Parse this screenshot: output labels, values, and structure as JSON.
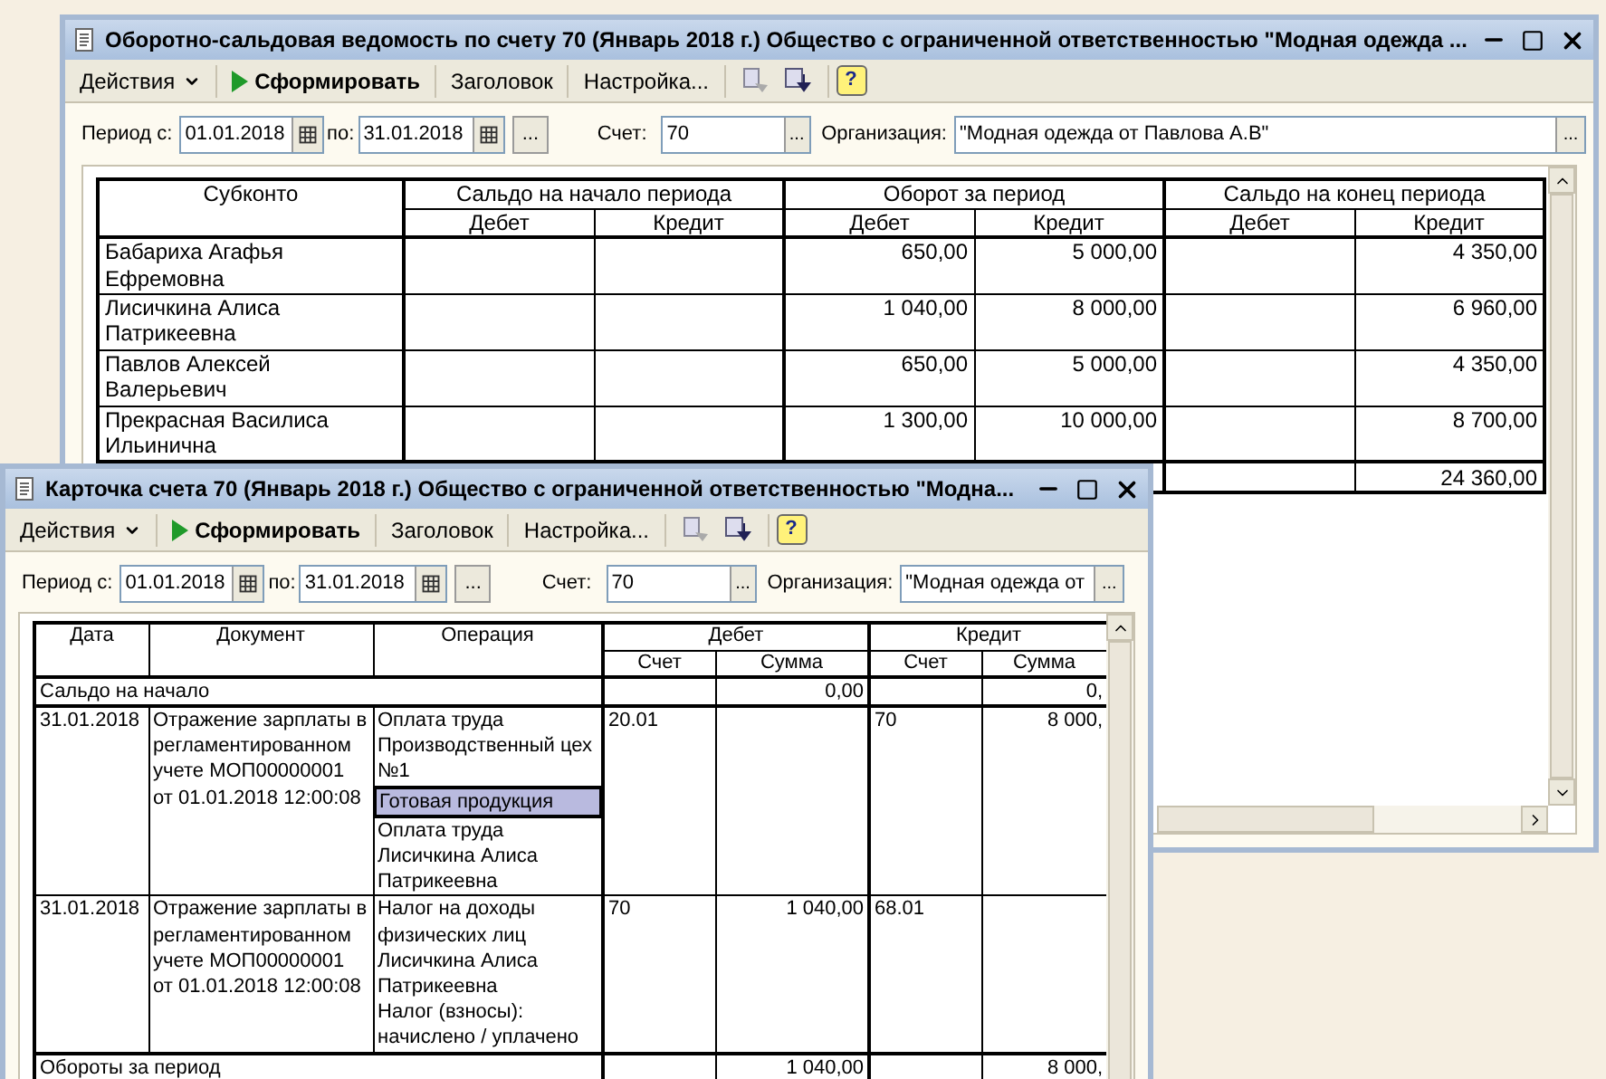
{
  "report_window": {
    "title": "Оборотно-сальдовая ведомость по счету 70 (Январь 2018 г.) Общество с ограниченной ответственностью \"Модная одежда ...",
    "toolbar": {
      "actions": "Действия",
      "generate": "Сформировать",
      "header": "Заголовок",
      "settings": "Настройка...",
      "help": "?"
    },
    "filter": {
      "period_label": "Период с:",
      "date_from": "01.01.2018",
      "to_label": "по:",
      "date_to": "31.01.2018",
      "period_button": "...",
      "account_label": "Счет:",
      "account": "70",
      "account_button": "...",
      "org_label": "Организация:",
      "org": "\"Модная одежда от Павлова А.В\"",
      "org_button": "..."
    },
    "table": {
      "first_column": "Субконто",
      "groups": [
        "Сальдо на начало периода",
        "Оборот за период",
        "Сальдо на конец периода"
      ],
      "subcolumns": [
        "Дебет",
        "Кредит",
        "Дебет",
        "Кредит",
        "Дебет",
        "Кредит"
      ],
      "rows": [
        {
          "name": "Бабариха Агафья Ефремовна",
          "turnover_debit": "650,00",
          "turnover_credit": "5 000,00",
          "closing_credit": "4 350,00"
        },
        {
          "name": "Лисичкина Алиса Патрикеевна",
          "turnover_debit": "1 040,00",
          "turnover_credit": "8 000,00",
          "closing_credit": "6 960,00"
        },
        {
          "name": "Павлов Алексей Валерьевич",
          "turnover_debit": "650,00",
          "turnover_credit": "5 000,00",
          "closing_credit": "4 350,00"
        },
        {
          "name": "Прекрасная Василиса Ильинична",
          "turnover_debit": "1 300,00",
          "turnover_credit": "10 000,00",
          "closing_credit": "8 700,00"
        }
      ],
      "total": {
        "closing_credit": "24 360,00"
      }
    }
  },
  "card_window": {
    "title": "Карточка счета 70 (Январь 2018 г.) Общество с ограниченной ответственностью \"Модна...",
    "toolbar": {
      "actions": "Действия",
      "generate": "Сформировать",
      "header": "Заголовок",
      "settings": "Настройка...",
      "help": "?"
    },
    "filter": {
      "period_label": "Период с:",
      "date_from": "01.01.2018",
      "to_label": "по:",
      "date_to": "31.01.2018",
      "period_button": "...",
      "account_label": "Счет:",
      "account": "70",
      "account_button": "...",
      "org_label": "Организация:",
      "org": "\"Модная одежда от",
      "org_button": "..."
    },
    "table": {
      "columns": [
        "Дата",
        "Документ",
        "Операция"
      ],
      "groups": [
        "Дебет",
        "Кредит"
      ],
      "subcolumns": [
        "Счет",
        "Сумма",
        "Счет",
        "Сумма"
      ],
      "rows": [
        {
          "kind": "summary",
          "label": "Сальдо на начало",
          "debit_sum": "0,00",
          "credit_sum": "0,"
        },
        {
          "kind": "entry",
          "date": "31.01.2018",
          "document": "Отражение зарплаты в регламентированном учете МОП00000001 от 01.01.2018 12:00:08",
          "operation": [
            {
              "text": "Оплата труда",
              "selected": false
            },
            {
              "text": "Производственный цех №1",
              "selected": false
            },
            {
              "text": "Готовая продукция",
              "selected": true
            },
            {
              "text": "Оплата труда",
              "selected": false
            },
            {
              "text": "Лисичкина Алиса Патрикеевна",
              "selected": false
            }
          ],
          "debit_account": "20.01",
          "credit_account": "70",
          "credit_sum": "8 000,"
        },
        {
          "kind": "entry",
          "date": "31.01.2018",
          "document": "Отражение зарплаты в регламентированном учете МОП00000001 от 01.01.2018 12:00:08",
          "operation": [
            {
              "text": "Налог на доходы физических лиц",
              "selected": false
            },
            {
              "text": "Лисичкина Алиса Патрикеевна",
              "selected": false
            },
            {
              "text": "Налог (взносы): начислено / уплачено",
              "selected": false
            }
          ],
          "debit_account": "70",
          "debit_sum": "1 040,00",
          "credit_account": "68.01"
        },
        {
          "kind": "summary",
          "label": "Обороты за период",
          "debit_sum": "1 040,00",
          "credit_sum": "8 000,"
        }
      ]
    }
  }
}
